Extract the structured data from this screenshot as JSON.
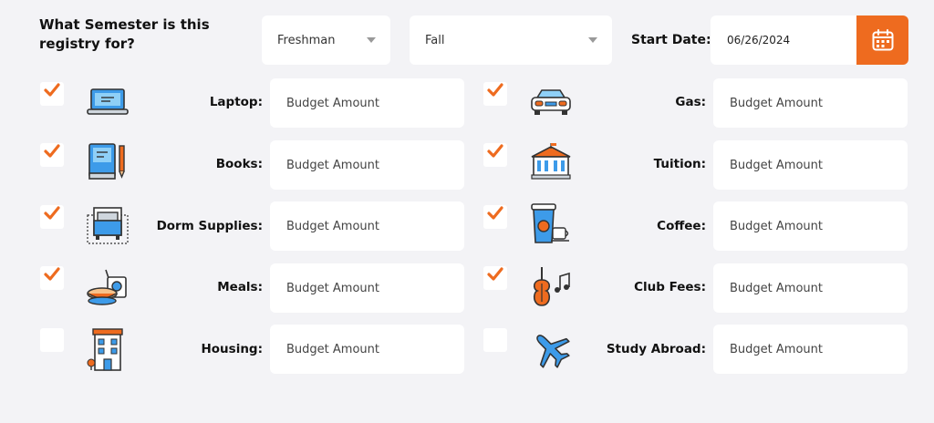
{
  "question": "What Semester is this registry for?",
  "year_select": {
    "value": "Freshman"
  },
  "term_select": {
    "value": "Fall"
  },
  "start_date": {
    "label": "Start Date:",
    "value": "06/26/2024"
  },
  "budget_placeholder": "Budget Amount",
  "items": [
    {
      "label": "Laptop:",
      "checked": true,
      "icon": "laptop-icon"
    },
    {
      "label": "Books:",
      "checked": true,
      "icon": "books-icon"
    },
    {
      "label": "Dorm Supplies:",
      "checked": true,
      "icon": "dorm-bed-icon"
    },
    {
      "label": "Meals:",
      "checked": true,
      "icon": "meals-icon"
    },
    {
      "label": "Housing:",
      "checked": false,
      "icon": "housing-building-icon"
    },
    {
      "label": "Gas:",
      "checked": true,
      "icon": "car-icon"
    },
    {
      "label": "Tuition:",
      "checked": true,
      "icon": "school-building-icon"
    },
    {
      "label": "Coffee:",
      "checked": true,
      "icon": "coffee-cup-icon"
    },
    {
      "label": "Club Fees:",
      "checked": true,
      "icon": "violin-music-icon"
    },
    {
      "label": "Study Abroad:",
      "checked": false,
      "icon": "airplane-icon"
    }
  ],
  "colors": {
    "accent": "#ee6b1f",
    "icon_blue": "#3d9be9",
    "background": "#f3f3f6"
  }
}
